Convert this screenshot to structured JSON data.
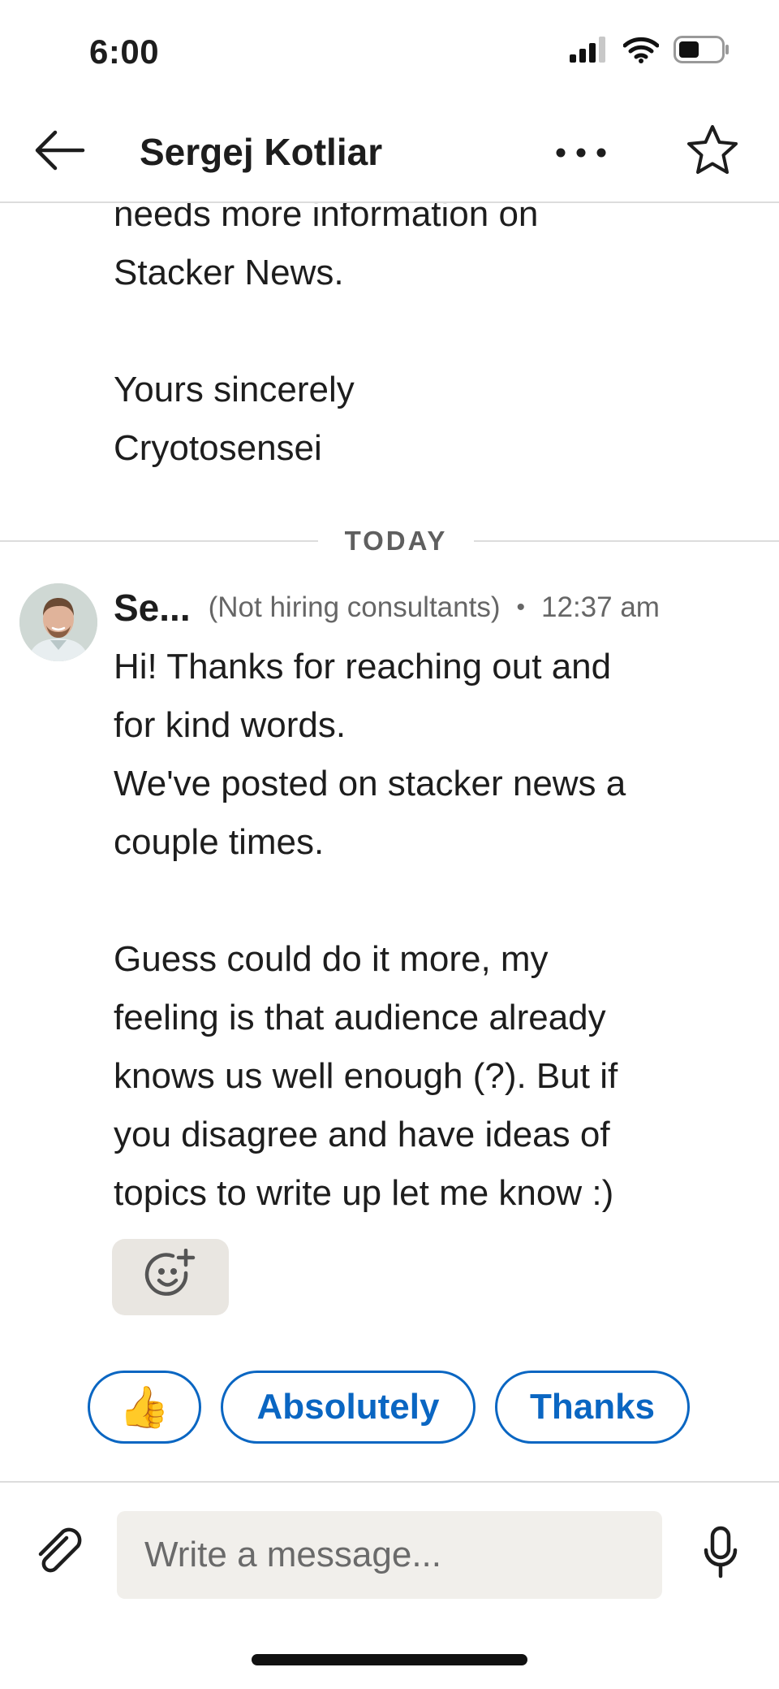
{
  "status_bar": {
    "time": "6:00"
  },
  "header": {
    "title": "Sergej Kotliar"
  },
  "conversation": {
    "previous_message_lines": [
      "needs more information on",
      "Stacker News.",
      "",
      "Yours sincerely",
      "Cryotosensei"
    ],
    "day_divider": "TODAY",
    "latest_message": {
      "sender": "Se...",
      "headline": "(Not hiring consultants)",
      "separator": "•",
      "time": "12:37 am",
      "lines": [
        "Hi! Thanks for reaching out and",
        "for kind words.",
        "We've posted on stacker news a",
        "couple times.",
        "",
        "Guess could do it more, my",
        "feeling is that audience already",
        "knows us well enough (?). But if",
        "you disagree and have ideas of",
        "topics to write up let me know :)"
      ]
    }
  },
  "quick_replies": [
    "👍",
    "Absolutely",
    "Thanks"
  ],
  "compose": {
    "placeholder": "Write a message..."
  },
  "icons": {
    "back": "arrow-left-icon",
    "more": "more-horizontal-icon",
    "star": "star-outline-icon",
    "react": "add-reaction-icon",
    "attach": "paperclip-icon",
    "mic": "microphone-icon",
    "signal": "signal-icon",
    "wifi": "wifi-icon",
    "battery": "battery-icon"
  },
  "colors": {
    "accent": "#0a66c2",
    "divider": "#dcdcdc",
    "input_bg": "#f1efeb"
  }
}
